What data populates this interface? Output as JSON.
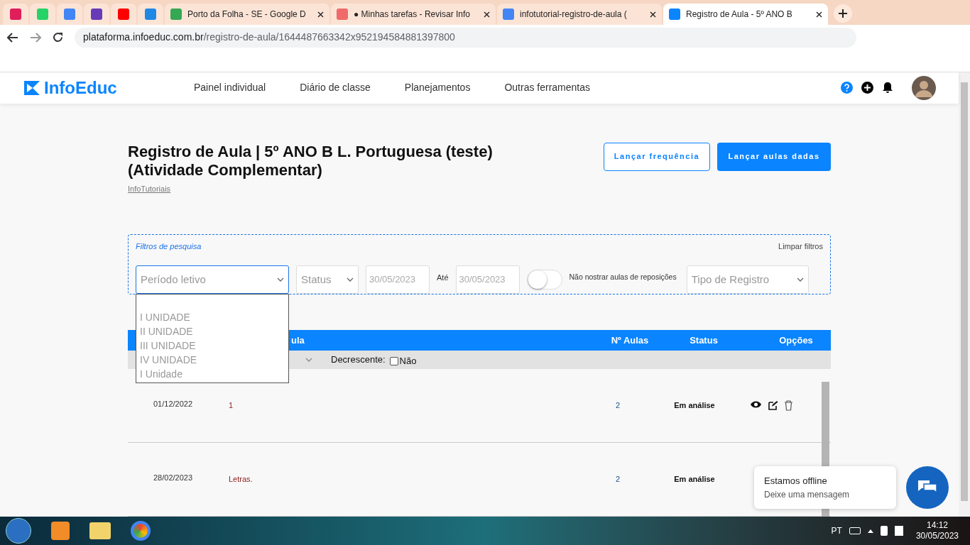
{
  "browser": {
    "tabs": [
      {
        "kind": "icon",
        "color": "#e01e5a",
        "selected": false
      },
      {
        "kind": "icon",
        "color": "#25d366",
        "selected": false
      },
      {
        "kind": "icon",
        "color": "#4285f4",
        "selected": false
      },
      {
        "kind": "icon",
        "color": "#673ab7",
        "selected": false
      },
      {
        "kind": "icon",
        "color": "#ff0000",
        "selected": false
      },
      {
        "kind": "icon",
        "color": "#1e88e5",
        "selected": false
      },
      {
        "kind": "titled",
        "title": "Porto da Folha - SE - Google D",
        "color": "#34a853",
        "selected": false
      },
      {
        "kind": "titled",
        "title": "● Minhas tarefas - Revisar Info",
        "color": "#f06a6a",
        "selected": false
      },
      {
        "kind": "titled",
        "title": "infotutorial-registro-de-aula (",
        "color": "#4285f4",
        "selected": false
      },
      {
        "kind": "titled",
        "title": "Registro de Aula - 5º ANO B",
        "color": "#0a84ff",
        "selected": true
      }
    ],
    "url_host": "plataforma.infoeduc.com.br",
    "url_path": "/registro-de-aula/1644487663342x952194584881397800"
  },
  "nav": {
    "logo": "InfoEduc",
    "items": [
      "Painel individual",
      "Diário de classe",
      "Planejamentos",
      "Outras ferramentas"
    ]
  },
  "header": {
    "title": "Registro de Aula | 5º ANO B L. Portuguesa (teste) (Atividade Complementar)",
    "link": "InfoTutoriais",
    "buttons": [
      {
        "label": "Lançar frequência",
        "kind": "outline"
      },
      {
        "label": "Lançar aulas dadas",
        "kind": "filled"
      }
    ]
  },
  "filters": {
    "title": "Filtros de pesquisa",
    "clear": "Limpar filtros",
    "period": {
      "placeholder": "Período letivo",
      "expanded": true,
      "options": [
        "I UNIDADE",
        "II UNIDADE",
        "III UNIDADE",
        "IV UNIDADE",
        "I Unidade"
      ]
    },
    "status": {
      "placeholder": "Status"
    },
    "date_from": "30/05/2023",
    "until": "Até",
    "date_to": "30/05/2023",
    "toggle": {
      "label": "Não nostrar aulas de reposições",
      "on": false
    },
    "type": {
      "placeholder": "Tipo de Registro"
    }
  },
  "table": {
    "columns": [
      "ula",
      "Nº Aulas",
      "Status",
      "Opções"
    ],
    "sort": {
      "label": "Decrescente:",
      "checkbox_label": "Não",
      "checked": false
    },
    "rows": [
      {
        "date": "01/12/2022",
        "description": "1",
        "lessons": "2",
        "status": "Em análise",
        "actions": true
      },
      {
        "date": "28/02/2023",
        "description": "Letras.",
        "lessons": "2",
        "status": "Em análise",
        "actions": false
      }
    ]
  },
  "chat": {
    "title": "Estamos offline",
    "subtitle": "Deixe uma mensagem"
  },
  "taskbar": {
    "language": "PT",
    "time": "14:12",
    "date": "30/05/2023"
  }
}
